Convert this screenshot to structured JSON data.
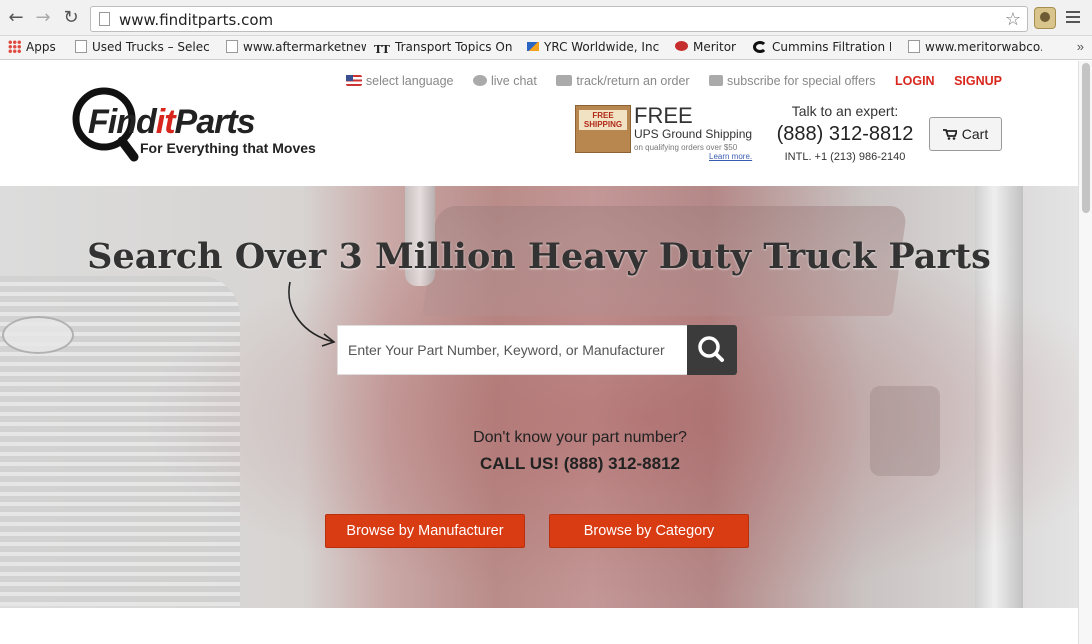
{
  "browser": {
    "url": "www.finditparts.com",
    "bookmarks": [
      {
        "label": "Apps"
      },
      {
        "label": "Used Trucks – Select"
      },
      {
        "label": "www.aftermarketnew"
      },
      {
        "label": "Transport Topics On"
      },
      {
        "label": "YRC Worldwide, Inc."
      },
      {
        "label": "Meritor"
      },
      {
        "label": "Cummins Filtration F"
      },
      {
        "label": "www.meritorwabco.c"
      }
    ],
    "bookmark_more": "»"
  },
  "toplinks": {
    "language": "select language",
    "chat": "live chat",
    "track": "track/return an order",
    "subscribe": "subscribe for special offers",
    "login": "LOGIN",
    "signup": "SIGNUP"
  },
  "logo": {
    "brand_find": "Find",
    "brand_it": "it",
    "brand_parts": "Parts",
    "tagline": "For Everything that Moves"
  },
  "shipping": {
    "box_label": "FREE SHIPPING",
    "free": "FREE",
    "ups": "UPS Ground Shipping",
    "qualify": "on qualifying orders over $50",
    "learn": "Learn more."
  },
  "expert": {
    "title": "Talk to an expert:",
    "phone": "(888) 312-8812",
    "intl": "INTL. +1 (213) 986-2140"
  },
  "cart": {
    "label": "Cart"
  },
  "hero": {
    "headline": "Search Over 3 Million Heavy Duty Truck Parts",
    "search_placeholder": "Enter Your Part Number, Keyword, or Manufacturer",
    "help_question": "Don't know your part number?",
    "help_call": "CALL US! (888) 312-8812",
    "browse_manufacturer": "Browse by Manufacturer",
    "browse_category": "Browse by Category"
  },
  "colors": {
    "accent_red": "#d9261c",
    "button_red": "#d93b12",
    "search_button": "#3b3b3b"
  }
}
